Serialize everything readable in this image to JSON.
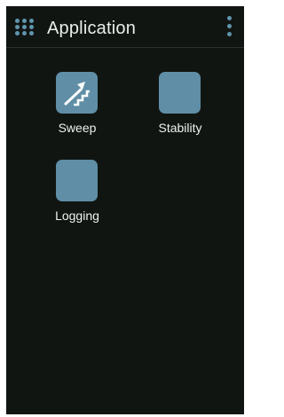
{
  "header": {
    "title": "Application",
    "apps_icon": "apps-grid-icon",
    "menu_icon": "more-vert-icon"
  },
  "apps": [
    {
      "label": "Sweep",
      "icon": "sweep-icon"
    },
    {
      "label": "Stability",
      "icon": "blank-app-icon"
    },
    {
      "label": "Logging",
      "icon": "blank-app-icon"
    }
  ],
  "colors": {
    "background": "#111512",
    "accent": "#5f94ad",
    "tile": "#5f8ea6",
    "text": "#e9eeea"
  }
}
